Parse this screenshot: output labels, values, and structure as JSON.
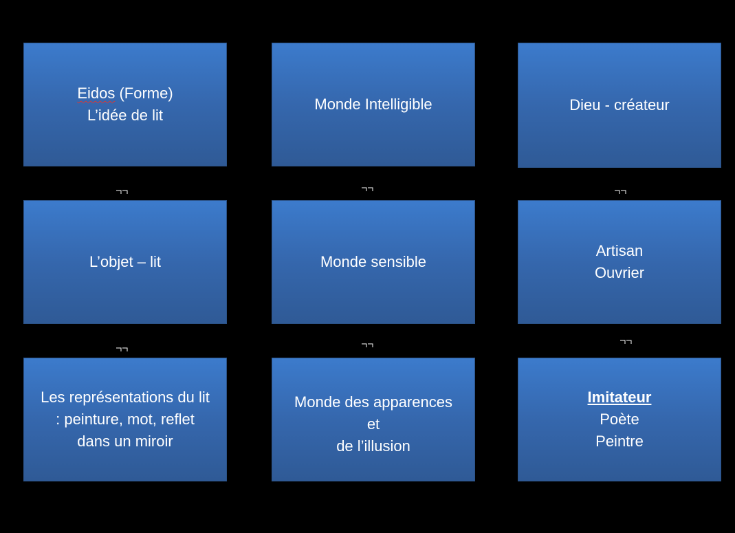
{
  "boxes": {
    "r1c1": {
      "line1": "Eidos",
      "line1b": " (Forme)",
      "line2": "L’idée de lit"
    },
    "r1c2": {
      "line1": "Monde Intelligible"
    },
    "r1c3": {
      "line1": "Dieu - créateur"
    },
    "r2c1": {
      "line1": "L’objet – lit"
    },
    "r2c2": {
      "line1": "Monde sensible"
    },
    "r2c3": {
      "line1": "Artisan",
      "line2": "Ouvrier"
    },
    "r3c1": {
      "line1": "Les représentations du lit",
      "line2": ": peinture, mot, reflet",
      "line3": "dans un miroir"
    },
    "r3c2": {
      "line1": "Monde des apparences",
      "line2": "et",
      "line3": "de l’illusion"
    },
    "r3c3": {
      "line1": "Imitateur",
      "line2": "Poète",
      "line3": "Peintre"
    }
  },
  "colors": {
    "background": "#000000",
    "box_top": "#3c7bcc",
    "box_bottom": "#2f5a96",
    "text": "#ffffff"
  }
}
